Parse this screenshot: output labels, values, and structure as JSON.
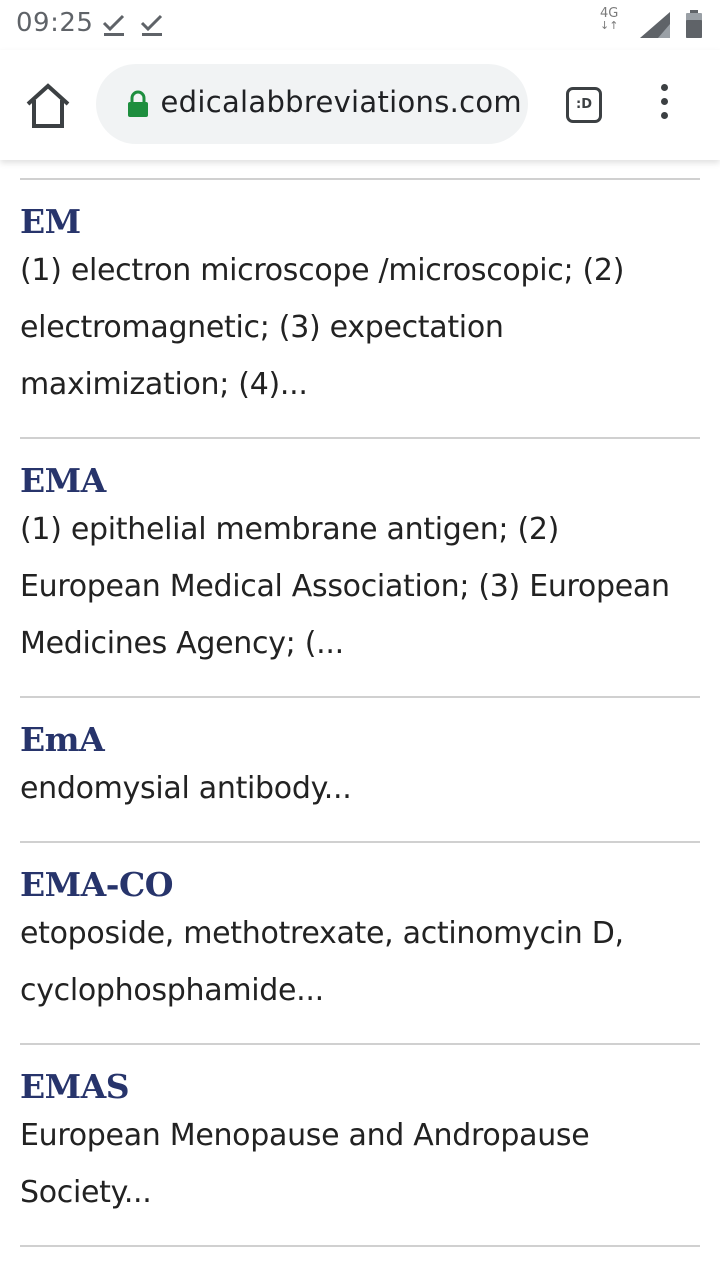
{
  "status_bar": {
    "time": "09:25",
    "network": "4G"
  },
  "browser": {
    "url": "medicalabbreviations.com",
    "tab_switcher_label": ":D"
  },
  "entries": [
    {
      "term": "EM",
      "definition": "(1) electron microscope /microscopic; (2) electromagnetic; (3) expectation maximization; (4)..."
    },
    {
      "term": "EMA",
      "definition": "(1) epithelial membrane antigen; (2) European Medical Association; (3) European Medicines Agency; (..."
    },
    {
      "term": "EmA",
      "definition": "endomysial antibody..."
    },
    {
      "term": "EMA-CO",
      "definition": "etoposide, methotrexate, actinomycin D, cyclophosphamide..."
    },
    {
      "term": "EMAS",
      "definition": "European Menopause and Andropause Society..."
    }
  ],
  "colors": {
    "term": "#27346b",
    "lock": "#1e8e3e",
    "divider": "#d0d0d0"
  }
}
